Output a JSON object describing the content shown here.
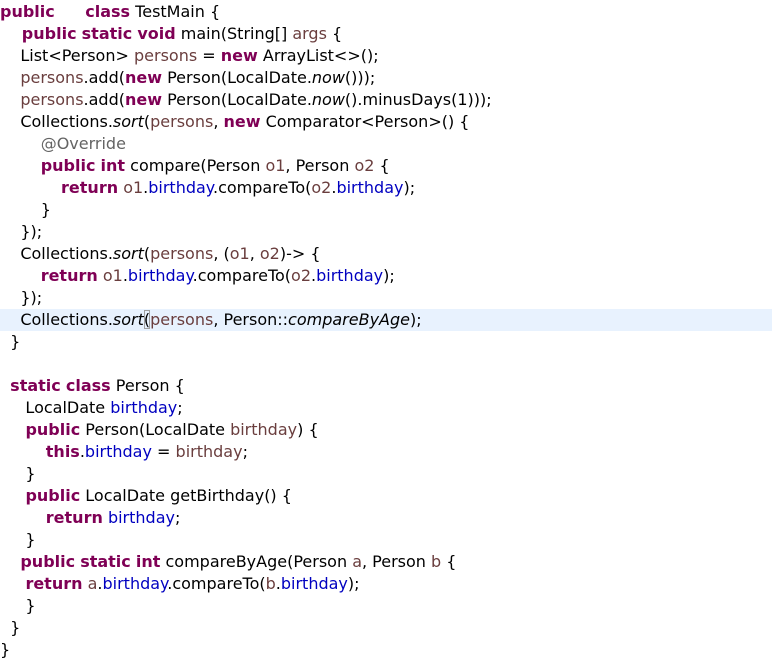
{
  "editor": {
    "current_line": 14,
    "lines": [
      [
        [
          "kw",
          "public"
        ],
        [
          "",
          "      "
        ],
        [
          "kw",
          "class"
        ],
        [
          "",
          " TestMain {"
        ]
      ],
      [
        [
          "",
          " "
        ],
        [
          "kw",
          "   public"
        ],
        [
          "",
          " "
        ],
        [
          "kw",
          "static"
        ],
        [
          "",
          " "
        ],
        [
          "kw",
          "void"
        ],
        [
          "",
          " main(String[] "
        ],
        [
          "lv",
          "args"
        ],
        [
          "",
          " {"
        ]
      ],
      [
        [
          "",
          "    List<Person> "
        ],
        [
          "lv",
          "persons"
        ],
        [
          "",
          " = "
        ],
        [
          "kw",
          "new"
        ],
        [
          "",
          " ArrayList<>();"
        ]
      ],
      [
        [
          "",
          "    "
        ],
        [
          "lv",
          "persons"
        ],
        [
          "",
          ".add("
        ],
        [
          "kw",
          "new"
        ],
        [
          "",
          " Person(LocalDate."
        ],
        [
          "st",
          "now"
        ],
        [
          "",
          "()));"
        ]
      ],
      [
        [
          "",
          "    "
        ],
        [
          "lv",
          "persons"
        ],
        [
          "",
          ".add("
        ],
        [
          "kw",
          "new"
        ],
        [
          "",
          " Person(LocalDate."
        ],
        [
          "st",
          "now"
        ],
        [
          "",
          "().minusDays(1)));"
        ]
      ],
      [
        [
          "",
          "    Collections."
        ],
        [
          "st",
          "sort"
        ],
        [
          "",
          "("
        ],
        [
          "lv",
          "persons"
        ],
        [
          "",
          ", "
        ],
        [
          "kw",
          "new"
        ],
        [
          "",
          " Comparator<Person>() {"
        ]
      ],
      [
        [
          "",
          "        "
        ],
        [
          "ann",
          "@Override"
        ]
      ],
      [
        [
          "",
          "        "
        ],
        [
          "kw",
          "public"
        ],
        [
          "",
          " "
        ],
        [
          "kw",
          "int"
        ],
        [
          "",
          " compare(Person "
        ],
        [
          "lv",
          "o1"
        ],
        [
          "",
          ", Person "
        ],
        [
          "lv",
          "o2"
        ],
        [
          "",
          " {"
        ]
      ],
      [
        [
          "",
          "            "
        ],
        [
          "kw",
          "return"
        ],
        [
          "",
          " "
        ],
        [
          "lv",
          "o1"
        ],
        [
          "",
          "."
        ],
        [
          "fld",
          "birthday"
        ],
        [
          "",
          ".compareTo("
        ],
        [
          "lv",
          "o2"
        ],
        [
          "",
          "."
        ],
        [
          "fld",
          "birthday"
        ],
        [
          "",
          ");"
        ]
      ],
      [
        [
          "",
          "        }"
        ]
      ],
      [
        [
          "",
          "    });"
        ]
      ],
      [
        [
          "",
          "    Collections."
        ],
        [
          "st",
          "sort"
        ],
        [
          "",
          "("
        ],
        [
          "lv",
          "persons"
        ],
        [
          "",
          ", ("
        ],
        [
          "lv",
          "o1"
        ],
        [
          "",
          ", "
        ],
        [
          "lv",
          "o2"
        ],
        [
          "",
          ")-> {"
        ]
      ],
      [
        [
          "",
          "        "
        ],
        [
          "kw",
          "return"
        ],
        [
          "",
          " "
        ],
        [
          "lv",
          "o1"
        ],
        [
          "",
          "."
        ],
        [
          "fld",
          "birthday"
        ],
        [
          "",
          ".compareTo("
        ],
        [
          "lv",
          "o2"
        ],
        [
          "",
          "."
        ],
        [
          "fld",
          "birthday"
        ],
        [
          "",
          ");"
        ]
      ],
      [
        [
          "",
          "    });"
        ]
      ],
      [
        [
          "",
          "    Collections."
        ],
        [
          "st",
          "sort"
        ],
        [
          "bracket",
          "("
        ],
        [
          "lv",
          "persons"
        ],
        [
          "",
          ", Person::"
        ],
        [
          "mref",
          "compareByAge"
        ],
        [
          "",
          ");"
        ]
      ],
      [
        [
          "",
          "  }"
        ]
      ],
      [
        [
          "",
          ""
        ]
      ],
      [
        [
          "",
          "  "
        ],
        [
          "kw",
          "static"
        ],
        [
          "",
          " "
        ],
        [
          "kw",
          "class"
        ],
        [
          "",
          " Person {"
        ]
      ],
      [
        [
          "",
          "     LocalDate "
        ],
        [
          "fld",
          "birthday"
        ],
        [
          "",
          ";"
        ]
      ],
      [
        [
          "",
          "     "
        ],
        [
          "kw",
          "public"
        ],
        [
          "",
          " Person(LocalDate "
        ],
        [
          "lv",
          "birthday"
        ],
        [
          "",
          ") {"
        ]
      ],
      [
        [
          "",
          "         "
        ],
        [
          "kw",
          "this"
        ],
        [
          "",
          "."
        ],
        [
          "fld",
          "birthday"
        ],
        [
          "",
          " = "
        ],
        [
          "lv",
          "birthday"
        ],
        [
          "",
          ";"
        ]
      ],
      [
        [
          "",
          "     }"
        ]
      ],
      [
        [
          "",
          "     "
        ],
        [
          "kw",
          "public"
        ],
        [
          "",
          " LocalDate getBirthday() {"
        ]
      ],
      [
        [
          "",
          "         "
        ],
        [
          "kw",
          "return"
        ],
        [
          "",
          " "
        ],
        [
          "fld",
          "birthday"
        ],
        [
          "",
          ";"
        ]
      ],
      [
        [
          "",
          "     }"
        ]
      ],
      [
        [
          "",
          "    "
        ],
        [
          "kw",
          "public"
        ],
        [
          "",
          " "
        ],
        [
          "kw",
          "static"
        ],
        [
          "",
          " "
        ],
        [
          "kw",
          "int"
        ],
        [
          "",
          " compareByAge(Person "
        ],
        [
          "lv",
          "a"
        ],
        [
          "",
          ", Person "
        ],
        [
          "lv",
          "b"
        ],
        [
          "",
          " {"
        ]
      ],
      [
        [
          "",
          "     "
        ],
        [
          "kw",
          "return"
        ],
        [
          "",
          " "
        ],
        [
          "lv",
          "a"
        ],
        [
          "",
          "."
        ],
        [
          "fld",
          "birthday"
        ],
        [
          "",
          ".compareTo("
        ],
        [
          "lv",
          "b"
        ],
        [
          "",
          "."
        ],
        [
          "fld",
          "birthday"
        ],
        [
          "",
          ");"
        ]
      ],
      [
        [
          "",
          "     }"
        ]
      ],
      [
        [
          "",
          "  }"
        ]
      ],
      [
        [
          "",
          "}"
        ]
      ]
    ]
  },
  "colors": {
    "keyword": "#7f0055",
    "local_variable": "#6a3e3e",
    "field": "#0000c0",
    "annotation": "#646464",
    "current_line_bg": "#e8f2fe"
  }
}
